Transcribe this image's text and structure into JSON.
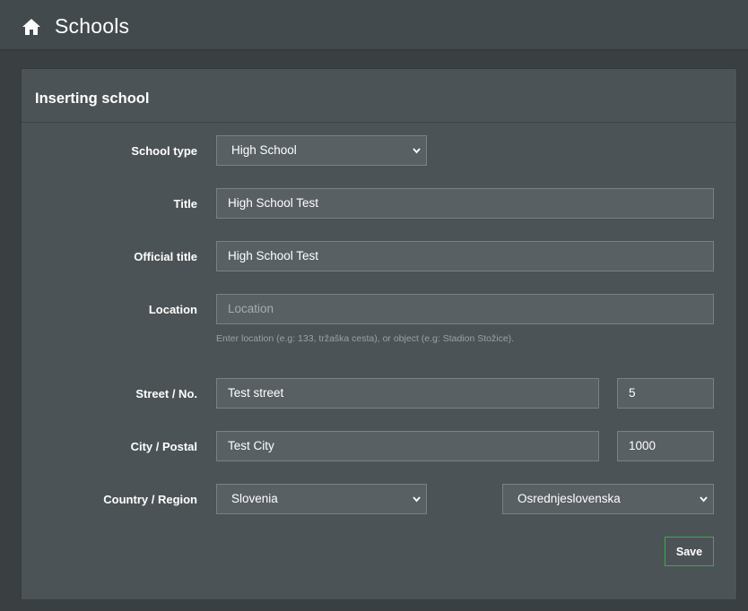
{
  "header": {
    "title": "Schools",
    "icon": "home-icon"
  },
  "panel": {
    "title": "Inserting school"
  },
  "form": {
    "school_type": {
      "label": "School type",
      "value": "High School"
    },
    "title": {
      "label": "Title",
      "value": "High School Test"
    },
    "official_title": {
      "label": "Official title",
      "value": "High School Test"
    },
    "location": {
      "label": "Location",
      "placeholder": "Location",
      "value": "",
      "help": "Enter location (e.g: 133, tržaška cesta), or object (e.g: Stadion Stožice)."
    },
    "street": {
      "label": "Street / No.",
      "street_value": "Test street",
      "number_value": "5"
    },
    "city": {
      "label": "City / Postal",
      "city_value": "Test City",
      "postal_value": "1000"
    },
    "country": {
      "label": "Country / Region",
      "country_value": "Slovenia",
      "region_value": "Osrednjeslovenska"
    },
    "save_label": "Save"
  },
  "colors": {
    "accent": "#2fb24a",
    "panel": "#4c5356",
    "topbar": "#434a4e",
    "field": "#596064"
  }
}
